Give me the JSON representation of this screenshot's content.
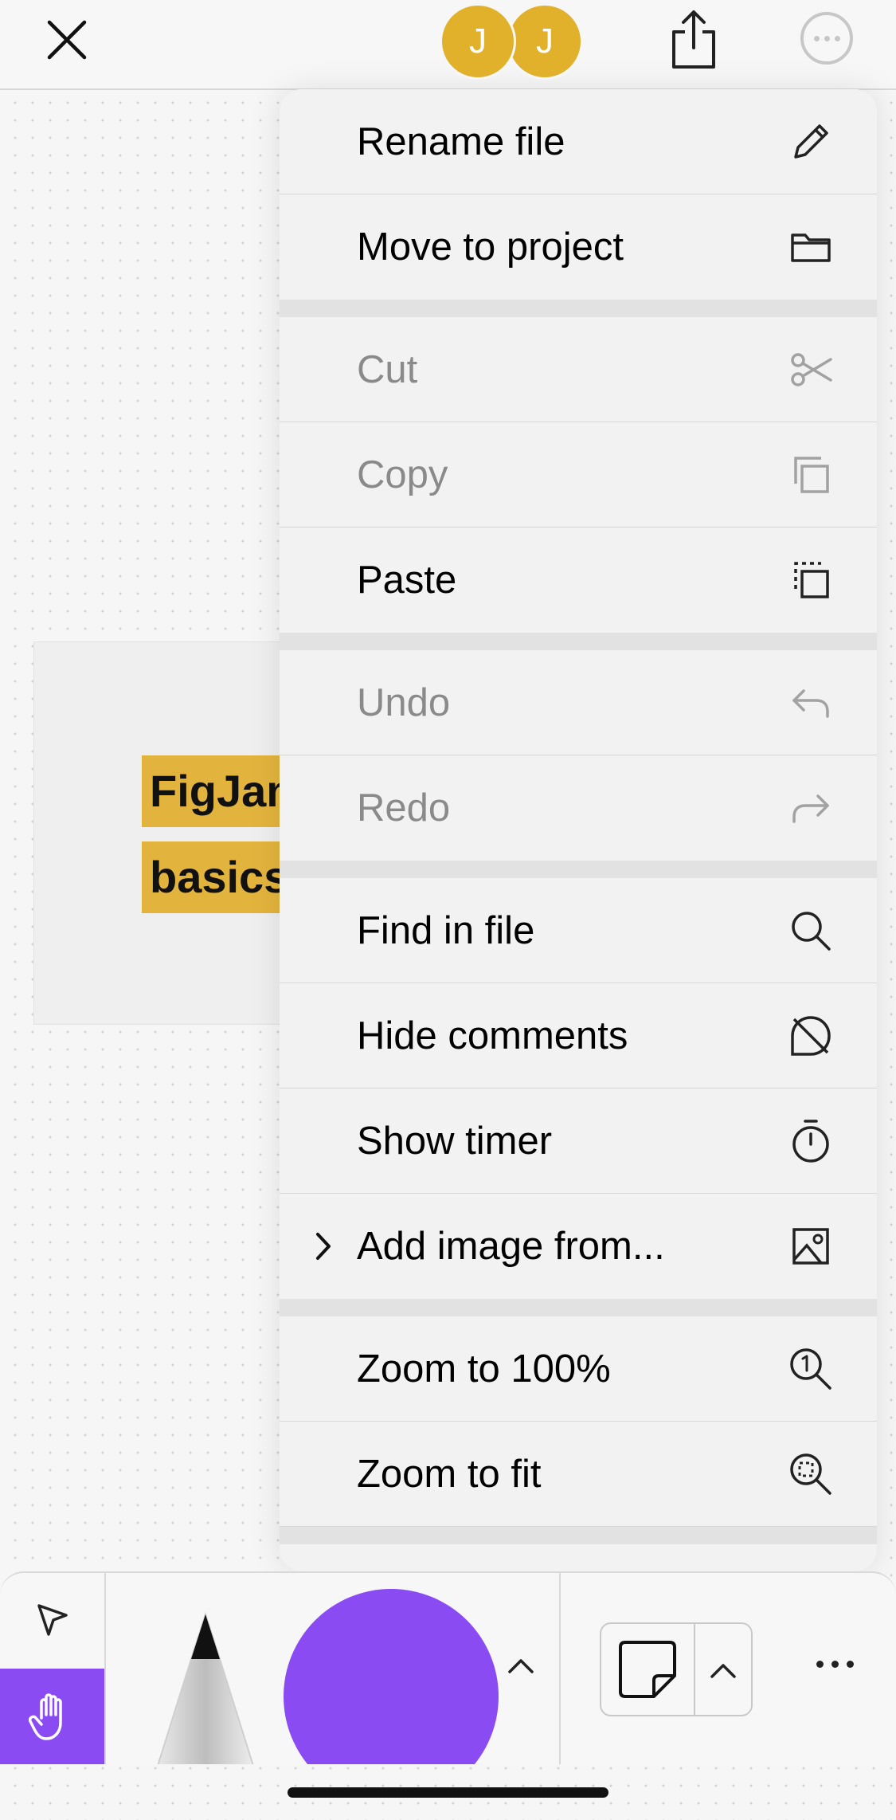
{
  "topbar": {
    "avatars": [
      {
        "initial": "J",
        "color": "#e1b12c"
      },
      {
        "initial": "J",
        "color": "#e1b12c"
      }
    ]
  },
  "board": {
    "title_line1": "FigJam",
    "title_line2": "basics",
    "highlight_color": "#e3b43d"
  },
  "menu": {
    "groups": [
      [
        {
          "label": "Rename file",
          "icon": "pencil-icon",
          "disabled": false
        },
        {
          "label": "Move to project",
          "icon": "folder-icon",
          "disabled": false
        }
      ],
      [
        {
          "label": "Cut",
          "icon": "scissors-icon",
          "disabled": true
        },
        {
          "label": "Copy",
          "icon": "copy-icon",
          "disabled": true
        },
        {
          "label": "Paste",
          "icon": "paste-icon",
          "disabled": false
        }
      ],
      [
        {
          "label": "Undo",
          "icon": "undo-icon",
          "disabled": true
        },
        {
          "label": "Redo",
          "icon": "redo-icon",
          "disabled": true
        }
      ],
      [
        {
          "label": "Find in file",
          "icon": "search-icon",
          "disabled": false
        },
        {
          "label": "Hide comments",
          "icon": "hide-comments-icon",
          "disabled": false
        },
        {
          "label": "Show timer",
          "icon": "timer-icon",
          "disabled": false
        },
        {
          "label": "Add image from...",
          "icon": "image-icon",
          "disabled": false,
          "submenu": true
        }
      ],
      [
        {
          "label": "Zoom to 100%",
          "icon": "zoom-100-icon",
          "disabled": false
        },
        {
          "label": "Zoom to fit",
          "icon": "zoom-fit-icon",
          "disabled": false
        }
      ]
    ]
  },
  "toolbar": {
    "active_tool": "hand",
    "accent_color": "#8a4cf2",
    "selected_color": "#8a4cf2"
  }
}
